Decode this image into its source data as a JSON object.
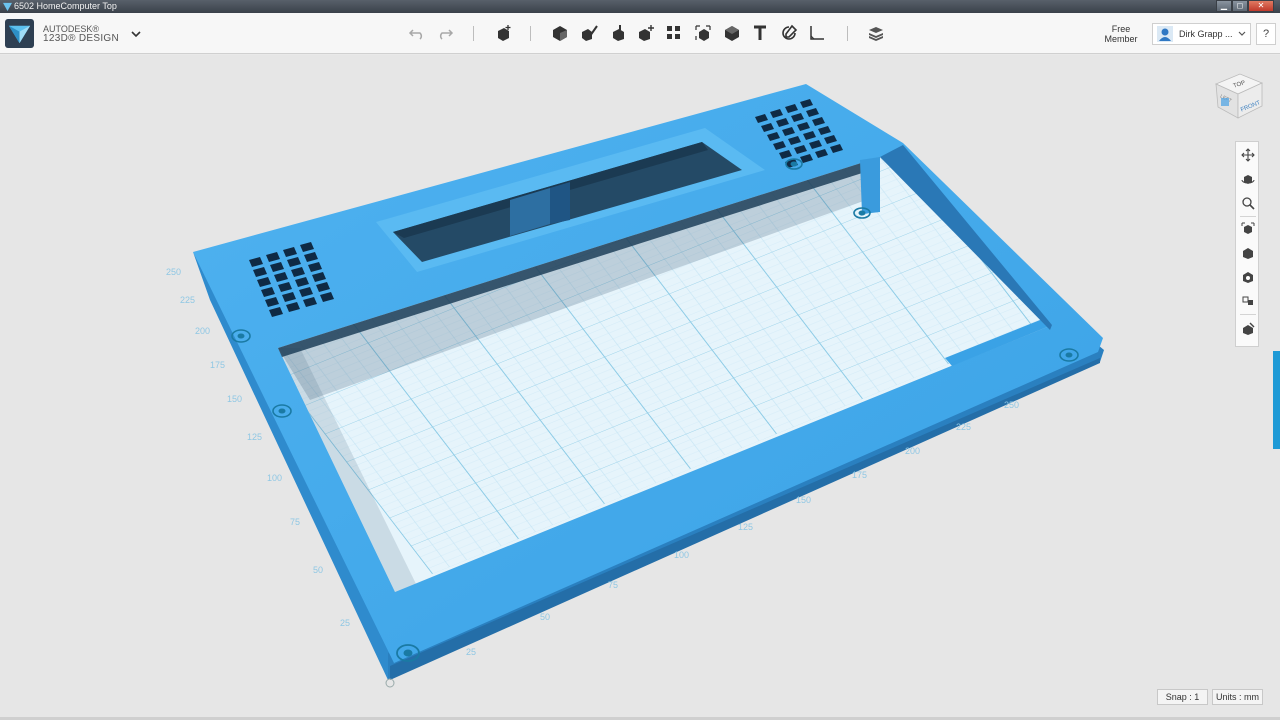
{
  "window": {
    "title": "6502 HomeComputer Top",
    "buttons": {
      "minimize": "▁",
      "maximize": "◻",
      "close": "✕"
    }
  },
  "brand": {
    "company": "AUTODESK®",
    "product": "123D® DESIGN"
  },
  "toolbar": {
    "tools": [
      {
        "name": "undo-icon"
      },
      {
        "name": "redo-icon"
      },
      {
        "name": "transform-icon"
      },
      {
        "name": "primitives-icon"
      },
      {
        "name": "sketch-icon"
      },
      {
        "name": "construct-icon"
      },
      {
        "name": "modify-icon"
      },
      {
        "name": "pattern-icon"
      },
      {
        "name": "group-icon"
      },
      {
        "name": "combine-icon"
      },
      {
        "name": "text-icon"
      },
      {
        "name": "snap-icon"
      },
      {
        "name": "measure-icon"
      },
      {
        "name": "material-icon"
      }
    ]
  },
  "account": {
    "member_line1": "Free",
    "member_line2": "Member",
    "user_name": "Dirk Grapp ..."
  },
  "help": {
    "label": "?"
  },
  "viewcube": {
    "top": "TOP",
    "front": "FRONT",
    "left": "LEFT"
  },
  "status": {
    "snap": "Snap : 1",
    "units": "Units : mm"
  },
  "grid": {
    "left_ticks": [
      "25",
      "50",
      "75",
      "100",
      "125",
      "150",
      "175",
      "200",
      "225",
      "250"
    ],
    "front_ticks": [
      "25",
      "50",
      "75",
      "100",
      "125",
      "150",
      "175",
      "200",
      "225",
      "250"
    ]
  },
  "colors": {
    "model": "#3ea8ec",
    "grid_line": "#9fd0ea",
    "accent": "#1e9ad6"
  }
}
